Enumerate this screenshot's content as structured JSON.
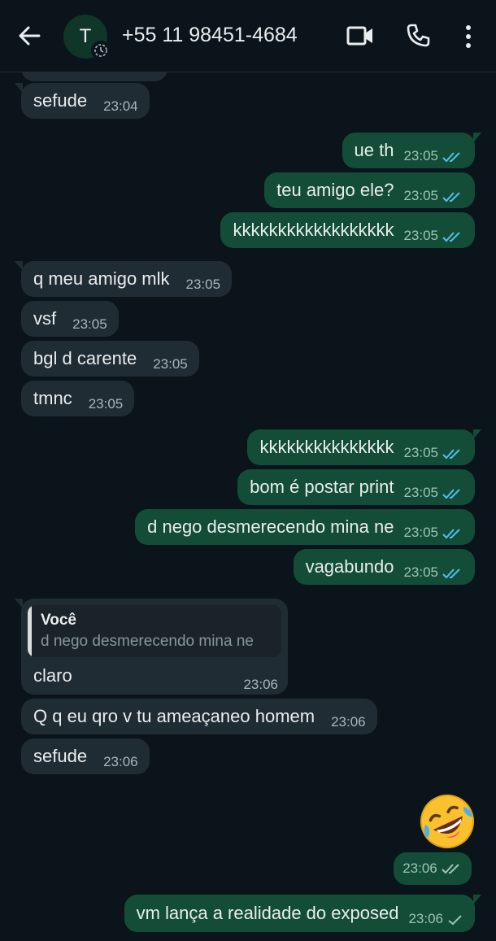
{
  "header": {
    "contact": "+55 11 98451-4684",
    "avatar_letter": "T"
  },
  "messages": [
    {
      "dir": "in",
      "text": "sefude",
      "time": "23:04"
    },
    {
      "dir": "out",
      "text": "ue th",
      "time": "23:05"
    },
    {
      "dir": "out",
      "text": "teu amigo ele?",
      "time": "23:05"
    },
    {
      "dir": "out",
      "text": "kkkkkkkkkkkkkkkkkk",
      "time": "23:05"
    },
    {
      "dir": "in",
      "text": "q meu amigo mlk",
      "time": "23:05"
    },
    {
      "dir": "in",
      "text": "vsf",
      "time": "23:05"
    },
    {
      "dir": "in",
      "text": "bgl d carente",
      "time": "23:05"
    },
    {
      "dir": "in",
      "text": "tmnc",
      "time": "23:05"
    },
    {
      "dir": "out",
      "text": "kkkkkkkkkkkkkkk",
      "time": "23:05"
    },
    {
      "dir": "out",
      "text": "bom é postar print",
      "time": "23:05"
    },
    {
      "dir": "out",
      "text": "d nego desmerecendo mina ne",
      "time": "23:05"
    },
    {
      "dir": "out",
      "text": "vagabundo",
      "time": "23:05"
    },
    {
      "dir": "in",
      "text": "Q q eu qro v tu ameaçaneo homem",
      "time": "23:06"
    },
    {
      "dir": "in",
      "text": "sefude",
      "time": "23:06"
    },
    {
      "dir": "out",
      "text": "vm lança a realidade do exposed",
      "time": "23:06"
    }
  ],
  "reply": {
    "quoted_author": "Você",
    "quoted_text": "d nego desmerecendo mina ne",
    "text": "claro",
    "time": "23:06"
  },
  "sticker": {
    "emoji": "rolling-on-floor-laughing",
    "time": "23:06"
  },
  "colors": {
    "background": "#0b141a",
    "incoming": "#202c33",
    "outgoing": "#134d37",
    "read_ticks": "#53bdeb"
  }
}
